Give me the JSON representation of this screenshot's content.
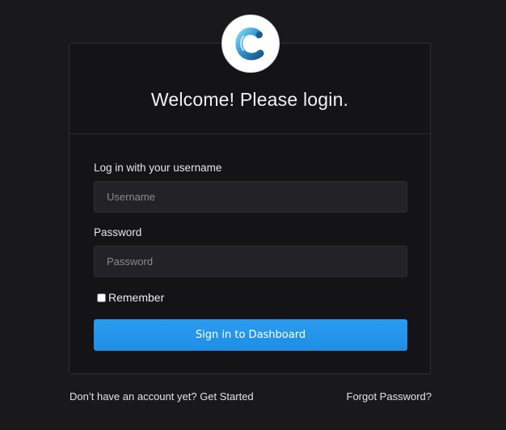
{
  "header": {
    "title": "Welcome! Please login."
  },
  "logo": {
    "icon": "c-logo-icon",
    "colors": {
      "dark": "#1b5a8e",
      "mid": "#2b8fd0",
      "light": "#7fd4f2"
    }
  },
  "form": {
    "username_label": "Log in with your username",
    "username_placeholder": "Username",
    "username_value": "",
    "password_label": "Password",
    "password_placeholder": "Password",
    "password_value": "",
    "remember_label": "Remember",
    "remember_checked": false,
    "submit_label": "Sign in to Dashboard"
  },
  "footer": {
    "signup_prompt": "Don’t have an account yet?",
    "signup_link": "Get Started",
    "forgot_link": "Forgot Password?"
  },
  "colors": {
    "background": "#19181b",
    "card": "#141316",
    "input": "#232226",
    "primary_button": "#2196f3"
  }
}
